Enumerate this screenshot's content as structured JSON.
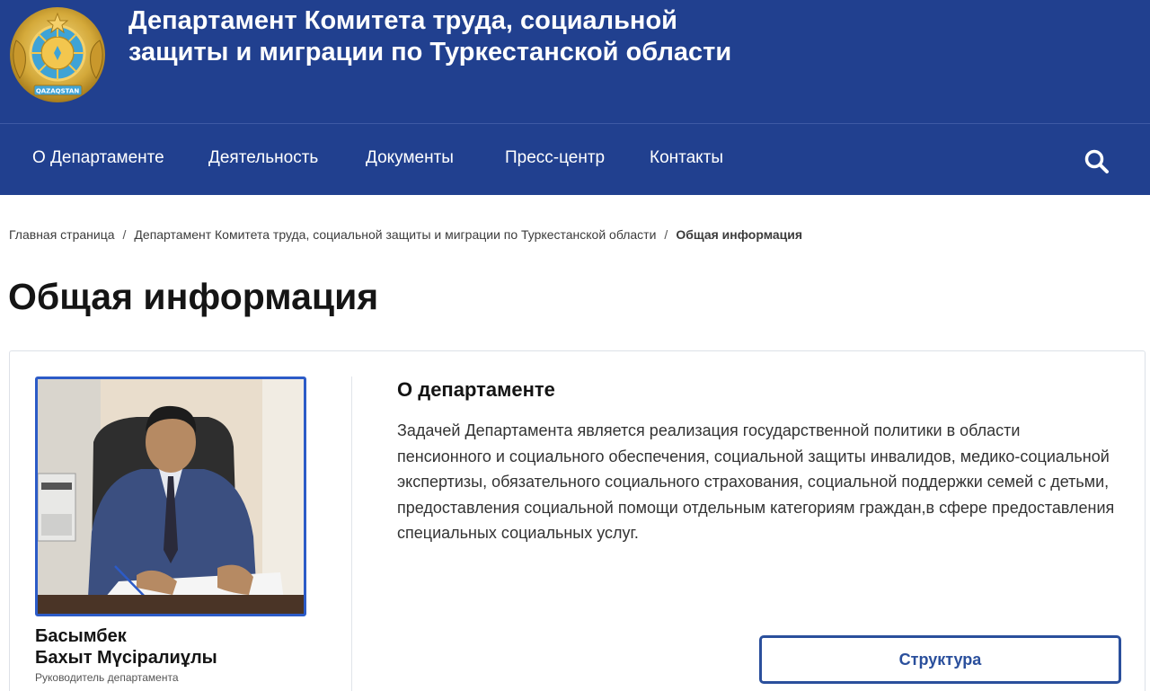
{
  "header": {
    "title_line1": "Департамент Комитета труда, социальной",
    "title_line2": "защиты и миграции по Туркестанской области",
    "emblem_text": "QAZAQSTAN"
  },
  "nav": {
    "items": [
      {
        "label": "О Департаменте"
      },
      {
        "label": "Деятельность"
      },
      {
        "label": "Документы"
      },
      {
        "label": "Пресс-центр"
      },
      {
        "label": "Контакты"
      }
    ],
    "search_icon": "search-icon"
  },
  "breadcrumb": {
    "home": "Главная страница",
    "parent": "Департамент Комитета труда, социальной защиты и миграции по Туркестанской области",
    "current": "Общая информация",
    "separator": "/"
  },
  "page": {
    "title": "Общая информация"
  },
  "head": {
    "name_line1": "Басымбек",
    "name_line2": "Бахыт Мүсіралиұлы",
    "role": "Руководитель департамента"
  },
  "about": {
    "title": "О департаменте",
    "text": "Задачей Департамента является реализация государственной политики в области пенсионного и социального обеспечения, социальной защиты инвалидов, медико-социальной экспертизы, обязательного социального страхования, социальной поддержки семей с детьми, предоставления социальной помощи отдельным категориям граждан,в сфере предоставления специальных социальных услуг.",
    "structure_button": "Структура"
  },
  "colors": {
    "header_bg": "#21408f",
    "accent": "#2a4f9c",
    "photo_border": "#2c5bc7"
  }
}
